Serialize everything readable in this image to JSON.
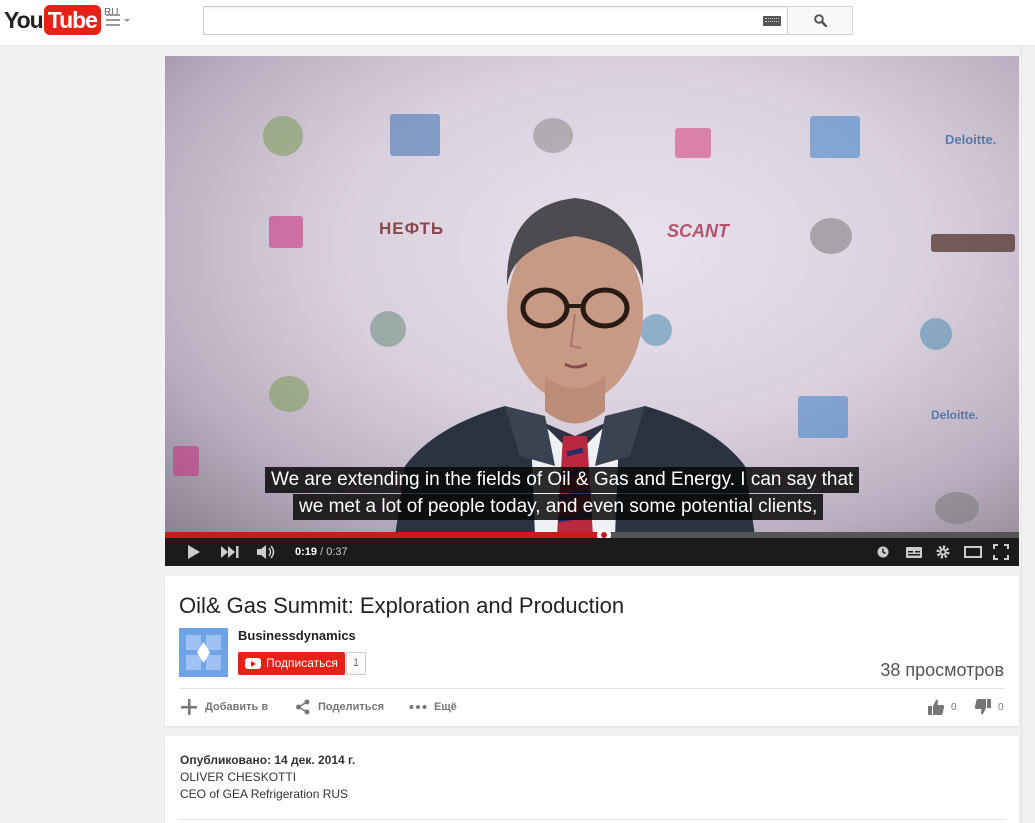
{
  "masthead": {
    "logo_you": "You",
    "logo_tube": "Tube",
    "region": "RU",
    "search_placeholder": "",
    "search_value": ""
  },
  "player": {
    "caption_line_1": "We are extending in the fields of Oil & Gas and Energy. I can say that",
    "caption_line_2": "we met a lot of people today, and even some potential clients,",
    "current_time": "0:19",
    "duration": " / 0:37",
    "progress": 0.5135,
    "backdrop_logos": [
      "НЕФТЬ",
      "SCANT",
      "Deloitte.",
      "Deloitte."
    ],
    "accent": "#cc181e"
  },
  "video": {
    "title": "Oil& Gas Summit: Exploration and Production",
    "channel": "Businessdynamics",
    "subscribe_label": "Подписаться",
    "subscriber_count": "1",
    "views": "38 просмотров",
    "actions": {
      "add_to": "Добавить в",
      "share": "Поделиться",
      "more": "Ещё"
    },
    "likes": "0",
    "dislikes": "0"
  },
  "description": {
    "published": "Опубликовано: 14 дек. 2014 г.",
    "line_1": "OLIVER CHESKOTTI",
    "line_2": "CEO of GEA Refrigeration RUS"
  }
}
